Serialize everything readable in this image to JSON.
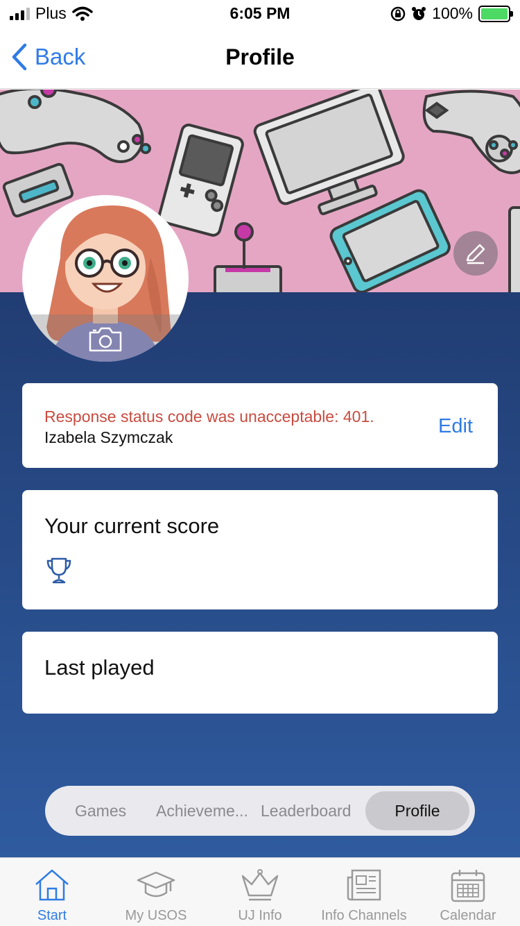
{
  "status_bar": {
    "carrier": "Plus",
    "time": "6:05 PM",
    "battery": "100%"
  },
  "nav": {
    "back_label": "Back",
    "title": "Profile"
  },
  "profile_card": {
    "error_message": "Response status code was unacceptable: 401.",
    "user_name": "Izabela Szymczak",
    "edit_label": "Edit"
  },
  "score_card": {
    "heading": "Your current score"
  },
  "last_played_card": {
    "heading": "Last played"
  },
  "segments": {
    "items": [
      "Games",
      "Achieveme...",
      "Leaderboard",
      "Profile"
    ],
    "selected": "Profile"
  },
  "tab_bar": {
    "items": [
      {
        "label": "Start",
        "icon": "home-icon",
        "active": true
      },
      {
        "label": "My USOS",
        "icon": "graduation-cap-icon",
        "active": false
      },
      {
        "label": "UJ Info",
        "icon": "crown-icon",
        "active": false
      },
      {
        "label": "Info Channels",
        "icon": "newspaper-icon",
        "active": false
      },
      {
        "label": "Calendar",
        "icon": "calendar-icon",
        "active": false
      }
    ]
  },
  "colors": {
    "accent": "#2f7be5",
    "error": "#c94b3f",
    "background_top": "#213d73",
    "background_bottom": "#2f5b9f",
    "banner_pink": "#e5a6c4"
  }
}
